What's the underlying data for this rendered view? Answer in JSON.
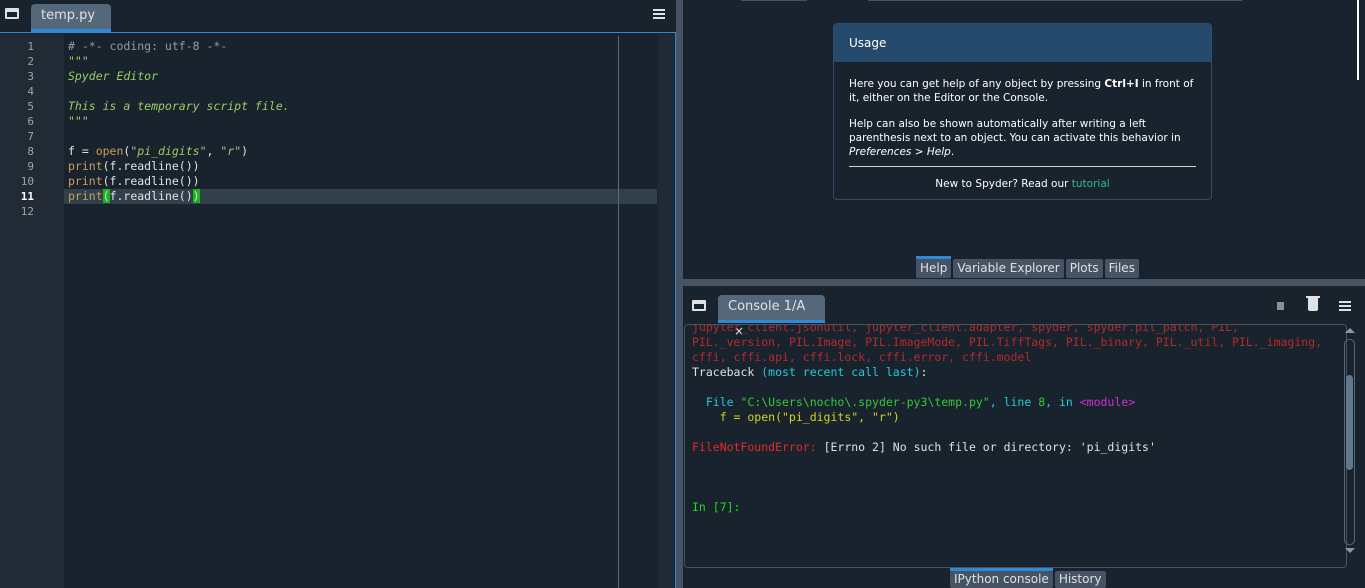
{
  "editor": {
    "tab_label": "temp.py",
    "tab_close": "×",
    "current_line": 11,
    "line_numbers": [
      "1",
      "2",
      "3",
      "4",
      "5",
      "6",
      "7",
      "8",
      "9",
      "10",
      "11",
      "12"
    ],
    "lines": [
      [
        {
          "t": "# -*- coding: utf-8 -*-",
          "c": "comment"
        }
      ],
      [
        {
          "t": "\"\"\"",
          "c": "doc"
        }
      ],
      [
        {
          "t": "Spyder Editor",
          "c": "doc"
        }
      ],
      [],
      [
        {
          "t": "This is a temporary script file.",
          "c": "doc"
        }
      ],
      [
        {
          "t": "\"\"\"",
          "c": "doc"
        }
      ],
      [],
      [
        {
          "t": "f = ",
          "c": "text"
        },
        {
          "t": "open",
          "c": "keyword"
        },
        {
          "t": "(",
          "c": "text"
        },
        {
          "t": "\"pi_digits\"",
          "c": "string"
        },
        {
          "t": ", ",
          "c": "text"
        },
        {
          "t": "\"r\"",
          "c": "string"
        },
        {
          "t": ")",
          "c": "text"
        }
      ],
      [
        {
          "t": "print",
          "c": "keyword"
        },
        {
          "t": "(f.readline())",
          "c": "text"
        }
      ],
      [
        {
          "t": "print",
          "c": "keyword"
        },
        {
          "t": "(f.readline())",
          "c": "text"
        }
      ],
      [
        {
          "t": "print",
          "c": "keyword"
        },
        {
          "t": "(",
          "c": "match"
        },
        {
          "t": "f.readline()",
          "c": "text"
        },
        {
          "t": ")",
          "c": "match"
        }
      ],
      []
    ]
  },
  "help": {
    "usage_title": "Usage",
    "para1_pre": "Here you can get help of any object by pressing ",
    "para1_key": "Ctrl+I",
    "para1_post": " in front of it, either on the Editor or the Console.",
    "para2_pre": "Help can also be shown automatically after writing a left parenthesis next to an object. You can activate this behavior in ",
    "para2_pref": "Preferences > Help",
    "para2_post": ".",
    "footer_text": "New to Spyder? Read our ",
    "footer_link": "tutorial",
    "tabs": [
      "Help",
      "Variable Explorer",
      "Plots",
      "Files"
    ],
    "active_tab": "Help"
  },
  "console": {
    "tab_label": "Console 1/A",
    "tab_close": "×",
    "output": [
      [
        {
          "t": "jupyter_client.jsonutil, jupyter_client.adapter, spyder, spyder.pil_patch, PIL,",
          "c": "darkred"
        }
      ],
      [
        {
          "t": "PIL._version, PIL.Image, PIL.ImageMode, PIL.TiffTags, PIL._binary, PIL._util, PIL._imaging,",
          "c": "darkred"
        }
      ],
      [
        {
          "t": "cffi, cffi.api, cffi.lock, cffi.error, cffi.model",
          "c": "darkred"
        }
      ],
      [
        {
          "t": "Traceback ",
          "c": "white"
        },
        {
          "t": "(most recent call last)",
          "c": "cyan"
        },
        {
          "t": ":",
          "c": "white"
        }
      ],
      [],
      [
        {
          "t": "  File ",
          "c": "cyan"
        },
        {
          "t": "\"C:\\Users\\nocho\\.spyder-py3\\temp.py\"",
          "c": "green"
        },
        {
          "t": ", line ",
          "c": "cyan"
        },
        {
          "t": "8",
          "c": "green"
        },
        {
          "t": ", in ",
          "c": "cyan"
        },
        {
          "t": "<module>",
          "c": "magenta"
        }
      ],
      [
        {
          "t": "    f = open(\"pi_digits\", \"r\")",
          "c": "yellow"
        }
      ],
      [],
      [
        {
          "t": "FileNotFoundError",
          "c": "red"
        },
        {
          "t": ": ",
          "c": "red"
        },
        {
          "t": "[Errno 2] No such file or directory: 'pi_digits'",
          "c": "white"
        }
      ],
      [],
      [],
      [],
      [
        {
          "t": "In [7]:",
          "c": "prompt"
        }
      ]
    ],
    "tabs": [
      "IPython console",
      "History"
    ],
    "active_tab": "IPython console"
  },
  "colors": {
    "background": "#19232d",
    "accent": "#2e8ad6",
    "tab_bg": "#54687a",
    "usage_header": "#264a6b",
    "link": "#2ebd8a"
  }
}
